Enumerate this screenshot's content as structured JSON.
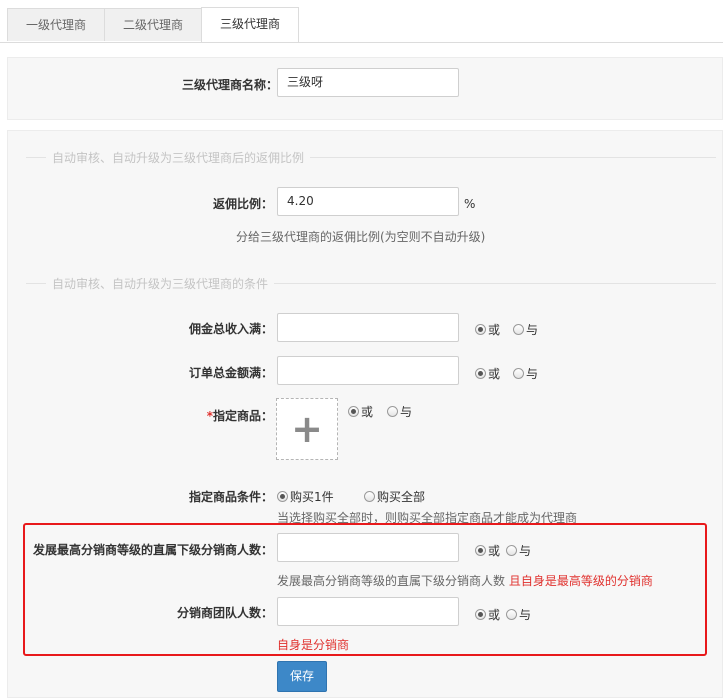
{
  "tabs": [
    {
      "label": "一级代理商",
      "active": false
    },
    {
      "label": "二级代理商",
      "active": false
    },
    {
      "label": "三级代理商",
      "active": true
    }
  ],
  "name_section": {
    "label": "三级代理商名称：",
    "value": "三级呀"
  },
  "commission_section": {
    "title": "自动审核、自动升级为三级代理商后的返佣比例",
    "rate_label": "返佣比例：",
    "rate_value": "4.20",
    "rate_unit": "%",
    "rate_hint": "分给三级代理商的返佣比例(为空则不自动升级)"
  },
  "conditions_section": {
    "title": "自动审核、自动升级为三级代理商的条件",
    "total_commission": {
      "label": "佣金总收入满：",
      "value": "",
      "opt_or": "或",
      "opt_and": "与",
      "selected": "或"
    },
    "order_total": {
      "label": "订单总金额满：",
      "value": "",
      "opt_or": "或",
      "opt_and": "与",
      "selected": "或"
    },
    "designated_goods": {
      "required_mark": "*",
      "label": "指定商品：",
      "opt_or": "或",
      "opt_and": "与",
      "selected": "或",
      "upload_icon": "plus-icon"
    },
    "goods_condition": {
      "label": "指定商品条件：",
      "opt_one": "购买1件",
      "opt_all": "购买全部",
      "selected": "购买1件",
      "hint": "当选择购买全部时，则购买全部指定商品才能成为代理商"
    },
    "direct_subordinates": {
      "label": "发展最高分销商等级的直属下级分销商人数：",
      "value": "",
      "opt_or": "或",
      "opt_and": "与",
      "selected": "或",
      "hint": "发展最高分销商等级的直属下级分销商人数",
      "hint_red": "且自身是最高等级的分销商"
    },
    "team_size": {
      "label": "分销商团队人数：",
      "value": "",
      "opt_or": "或",
      "opt_and": "与",
      "selected": "或",
      "hint_red": "自身是分销商"
    }
  },
  "save_label": "保存",
  "colors": {
    "accent_blue": "#3d88c8",
    "highlight_red": "#e8191b",
    "warning_red": "#e0312e"
  }
}
